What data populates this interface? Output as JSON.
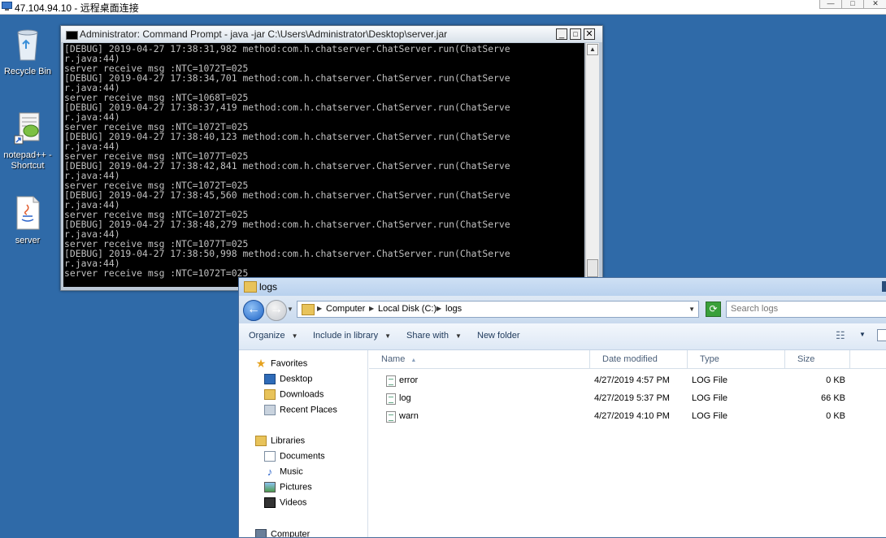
{
  "rdp": {
    "title": "47.104.94.10 - 远程桌面连接",
    "buttons": [
      "—",
      "□",
      "✕"
    ]
  },
  "desktop": {
    "icons": [
      {
        "label": "Recycle Bin"
      },
      {
        "label": "notepad++ - Shortcut"
      },
      {
        "label": "server"
      }
    ]
  },
  "cmd": {
    "title": "Administrator: Command Prompt - java  -jar C:\\Users\\Administrator\\Desktop\\server.jar",
    "lines": [
      "[DEBUG] 2019-04-27 17:38:31,982 method:com.h.chatserver.ChatServer.run(ChatServe",
      "r.java:44)",
      "server receive msg :NTC=1072T=025",
      "[DEBUG] 2019-04-27 17:38:34,701 method:com.h.chatserver.ChatServer.run(ChatServe",
      "r.java:44)",
      "server receive msg :NTC=1068T=025",
      "[DEBUG] 2019-04-27 17:38:37,419 method:com.h.chatserver.ChatServer.run(ChatServe",
      "r.java:44)",
      "server receive msg :NTC=1072T=025",
      "[DEBUG] 2019-04-27 17:38:40,123 method:com.h.chatserver.ChatServer.run(ChatServe",
      "r.java:44)",
      "server receive msg :NTC=1077T=025",
      "[DEBUG] 2019-04-27 17:38:42,841 method:com.h.chatserver.ChatServer.run(ChatServe",
      "r.java:44)",
      "server receive msg :NTC=1072T=025",
      "[DEBUG] 2019-04-27 17:38:45,560 method:com.h.chatserver.ChatServer.run(ChatServe",
      "r.java:44)",
      "server receive msg :NTC=1072T=025",
      "[DEBUG] 2019-04-27 17:38:48,279 method:com.h.chatserver.ChatServer.run(ChatServe",
      "r.java:44)",
      "server receive msg :NTC=1077T=025",
      "[DEBUG] 2019-04-27 17:38:50,998 method:com.h.chatserver.ChatServer.run(ChatServe",
      "r.java:44)",
      "server receive msg :NTC=1072T=025"
    ]
  },
  "explorer": {
    "title": "logs",
    "breadcrumb": [
      "Computer",
      "Local Disk (C:)",
      "logs"
    ],
    "search_placeholder": "Search logs",
    "toolbar": {
      "organize": "Organize",
      "include": "Include in library",
      "share": "Share with",
      "new_folder": "New folder"
    },
    "nav": {
      "favorites": "Favorites",
      "desktop": "Desktop",
      "downloads": "Downloads",
      "recent": "Recent Places",
      "libraries": "Libraries",
      "documents": "Documents",
      "music": "Music",
      "pictures": "Pictures",
      "videos": "Videos",
      "computer": "Computer"
    },
    "columns": {
      "name": "Name",
      "date": "Date modified",
      "type": "Type",
      "size": "Size"
    },
    "files": [
      {
        "name": "error",
        "date": "4/27/2019 4:57 PM",
        "type": "LOG File",
        "size": "0 KB"
      },
      {
        "name": "log",
        "date": "4/27/2019 5:37 PM",
        "type": "LOG File",
        "size": "66 KB"
      },
      {
        "name": "warn",
        "date": "4/27/2019 4:10 PM",
        "type": "LOG File",
        "size": "0 KB"
      }
    ]
  }
}
